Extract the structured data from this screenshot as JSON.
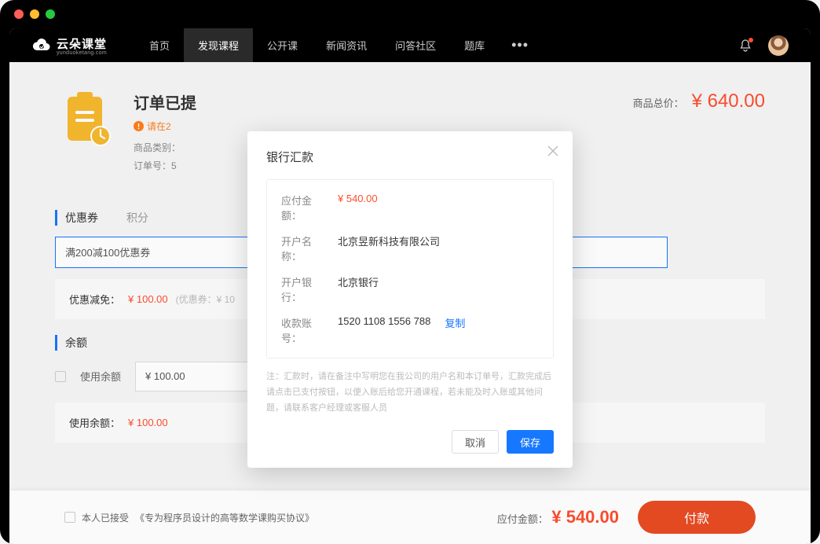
{
  "nav": {
    "logo_text": "云朵课堂",
    "logo_sub": "yunduoketang.com",
    "items": [
      "首页",
      "发现课程",
      "公开课",
      "新闻资讯",
      "问答社区",
      "题库"
    ],
    "active_index": 1
  },
  "order": {
    "title": "订单已提",
    "warning": "请在2",
    "category_label": "商品类别：",
    "orderno_label": "订单号：5",
    "total_label": "商品总价：",
    "total_price": "¥  640.00"
  },
  "coupon": {
    "tabs": [
      "优惠券",
      "积分"
    ],
    "input_value": "满200减100优惠券",
    "discount_label": "优惠减免：",
    "discount_price": "¥ 100.00",
    "discount_note": "(优惠券：¥ 10"
  },
  "balance": {
    "section_label": "余额",
    "use_label": "使用余额",
    "input_value": "¥ 100.00",
    "used_label": "使用余额：",
    "used_price": "¥ 100.00"
  },
  "footer": {
    "agree_prefix": "本人已接受",
    "agree_link": "《专为程序员设计的高等数学课购买协议》",
    "due_label": "应付金额：",
    "due_price": "¥  540.00",
    "pay_btn": "付款"
  },
  "modal": {
    "title": "银行汇款",
    "rows": {
      "amount_label": "应付金额：",
      "amount_value": "¥ 540.00",
      "account_name_label": "开户名称：",
      "account_name_value": "北京昱新科技有限公司",
      "bank_label": "开户银行：",
      "bank_value": "北京银行",
      "account_no_label": "收款账号：",
      "account_no_value": "1520 1108 1556 788",
      "copy": "复制"
    },
    "note": "注：汇款时，请在备注中写明您在我公司的用户名和本订单号，汇款完成后请点击已支付按钮，以便入账后给您开通课程，若未能及时入账或其他问题，请联系客户经理或客服人员",
    "cancel": "取消",
    "save": "保存"
  }
}
